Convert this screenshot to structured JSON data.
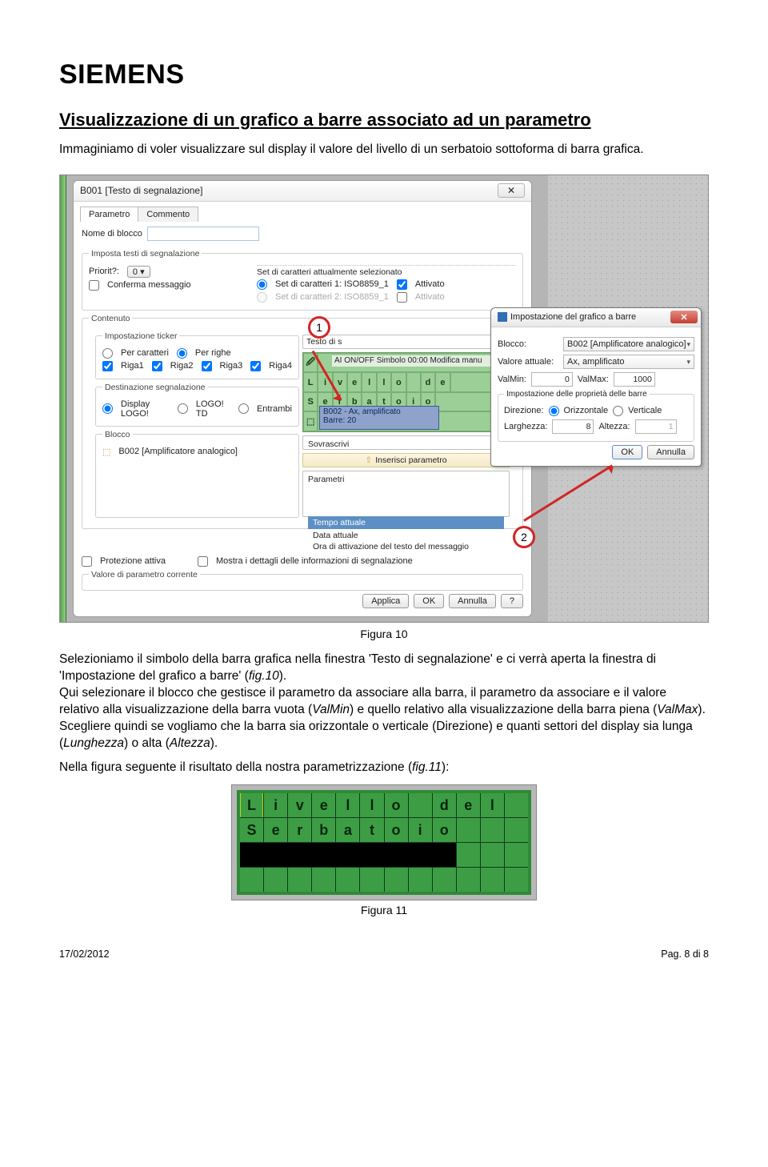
{
  "logo": "SIEMENS",
  "title": "Visualizzazione di un grafico a barre associato ad un parametro",
  "intro": "Immaginiamo di voler visualizzare sul display il valore del livello di un serbatoio sottoforma di barra grafica.",
  "figure10": {
    "caption": "Figura 10",
    "callout1": "1",
    "callout2": "2",
    "window": {
      "title": "B001 [Testo di segnalazione]",
      "tabs": {
        "t1": "Parametro",
        "t2": "Commento"
      },
      "blockname_label": "Nome di blocco",
      "fs_imposta": "Imposta testi di segnalazione",
      "priorita_label": "Priorit?:",
      "priorita_value": "0",
      "conferma": "Conferma messaggio",
      "charset_title": "Set di caratteri attualmente selezionato",
      "charset1": "Set di caratteri 1: ISO8859_1",
      "charset2": "Set di caratteri 2: ISO8859_1",
      "attivato": "Attivato",
      "fs_contenuto": "Contenuto",
      "fs_ticker": "Impostazione ticker",
      "per_caratteri": "Per caratteri",
      "per_righe": "Per righe",
      "riga1": "Riga1",
      "riga2": "Riga2",
      "riga3": "Riga3",
      "riga4": "Riga4",
      "fs_dest": "Destinazione segnalazione",
      "disp_logo": "Display LOGO!",
      "logo_td": "LOGO! TD",
      "entrambi": "Entrambi",
      "fs_blocco": "Blocco",
      "blocco_item": "B002 [Amplificatore analogico]",
      "testodi": "Testo di s",
      "aion": "AI ON/OFF Simbolo 00:00 Modifica manu",
      "row2": [
        "L",
        "i",
        "v",
        "e",
        "l",
        "l",
        "o",
        "",
        "d",
        "e"
      ],
      "row3": [
        "S",
        "e",
        "r",
        "b",
        "a",
        "t",
        "o",
        "i",
        "o"
      ],
      "barbox_top": "B002 - Ax, amplificato",
      "barbox_bot": "Barre:    20",
      "sovrascrivi": "Sovrascrivi",
      "inserisci": "Inserisci parametro",
      "parametri": "Parametri",
      "tempo": "Tempo attuale",
      "data": "Data attuale",
      "ora": "Ora di attivazione del testo del messaggio",
      "prot": "Protezione attiva",
      "mostra": "Mostra i dettagli delle informazioni di segnalazione",
      "valparam": "Valore di parametro corrente",
      "btn_applica": "Applica",
      "btn_ok": "OK",
      "btn_annulla": "Annulla",
      "btn_q": "?"
    },
    "popup": {
      "title": "Impostazione del grafico a barre",
      "blocco_label": "Blocco:",
      "blocco_value": "B002 [Amplificatore analogico]",
      "valatt_label": "Valore attuale:",
      "valatt_value": "Ax, amplificato",
      "valmin_label": "ValMin:",
      "valmin_value": "0",
      "valmax_label": "ValMax:",
      "valmax_value": "1000",
      "fs_prop": "Impostazione delle proprietà delle barre",
      "dir_label": "Direzione:",
      "dir_h": "Orizzontale",
      "dir_v": "Verticale",
      "larg_label": "Larghezza:",
      "larg_val": "8",
      "alt_label": "Altezza:",
      "alt_val": "1",
      "ok": "OK",
      "annulla": "Annulla"
    }
  },
  "para2a": "Selezioniamo il simbolo della barra grafica nella finestra 'Testo di segnalazione' e ci verrà aperta la finestra di 'Impostazione del grafico a barre' (",
  "para2a_fig": "fig.10",
  "para2a_end": ").",
  "para2b": "Qui selezionare il blocco che gestisce il parametro da associare alla barra, il parametro da associare e il valore relativo alla visualizzazione della barra vuota (",
  "valmin_i": "ValMin",
  "para2c": ") e quello relativo alla visualizzazione della barra piena (",
  "valmax_i": "ValMax",
  "para2d": "). Scegliere quindi se vogliamo che la barra sia orizzontale o verticale (Direzione) e quanti settori del display sia lunga (",
  "lung_i": "Lunghezza",
  "para2e": ") o alta (",
  "alt_i": "Altezza",
  "para2f": ").",
  "para3a": "Nella figura seguente il risultato della nostra parametrizzazione (",
  "para3_fig": "fig.11",
  "para3b": "):",
  "figure11": {
    "caption": "Figura 11",
    "row1": [
      "L",
      "i",
      "v",
      "e",
      "l",
      "l",
      "o",
      "",
      "d",
      "e",
      "l",
      ""
    ],
    "row2": [
      "S",
      "e",
      "r",
      "b",
      "a",
      "t",
      "o",
      "i",
      "o",
      "",
      "",
      ""
    ]
  },
  "footer": {
    "date": "17/02/2012",
    "page": "Pag. 8 di 8"
  }
}
